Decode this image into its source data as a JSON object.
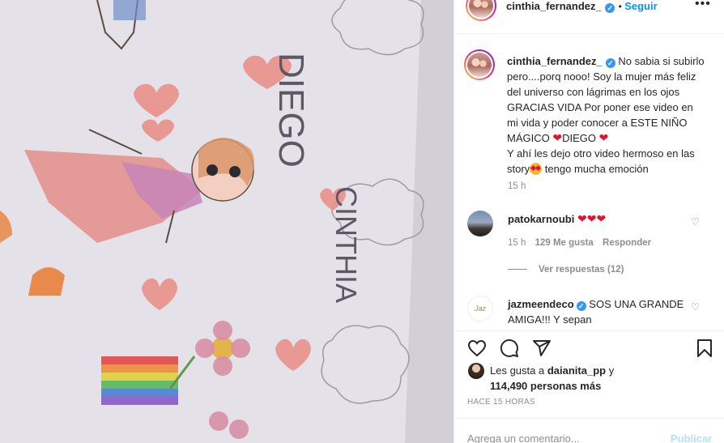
{
  "post": {
    "author": "cinthia_fernandez_",
    "follow_label": "Seguir",
    "more_label": "•••",
    "caption": {
      "part1": "No sabia si subirlo pero....porq nooo! Soy la mujer más feliz del universo con lágrimas en los ojos GRACIAS VIDA Por poner ese video en mi vida y poder conocer a ESTE NIÑO MÁGICO",
      "part2": "DIEGO",
      "part3": "Y ahí les dejo otro video hermoso en las story",
      "part4": "tengo mucha emoción",
      "time": "15 h"
    },
    "photo": {
      "text_diego": "DIEGO",
      "text_cinthia": "CINTHIA"
    }
  },
  "comments": [
    {
      "user": "patokarnoubi",
      "time": "15 h",
      "likes": "129 Me gusta",
      "reply_label": "Responder",
      "replies_label": "Ver respuestas (12)"
    },
    {
      "user": "jazmeendeco",
      "text": "SOS UNA GRANDE AMIGA!!! Y sepan"
    }
  ],
  "likes": {
    "prefix": "Les gusta a",
    "user": "daianita_pp",
    "connector": "y",
    "count": "114,490 personas más"
  },
  "timestamp": "HACE 15 HORAS",
  "comment_input": {
    "placeholder": "Agrega un comentario...",
    "publish_label": "Publicar"
  },
  "icons": [
    "heart-icon",
    "comment-icon",
    "share-icon",
    "bookmark-icon",
    "verified-icon",
    "more-icon"
  ],
  "colors": {
    "link": "#0095f6",
    "verified": "#3897f0",
    "muted": "#8e8e8e",
    "heart": "#e0142a"
  }
}
